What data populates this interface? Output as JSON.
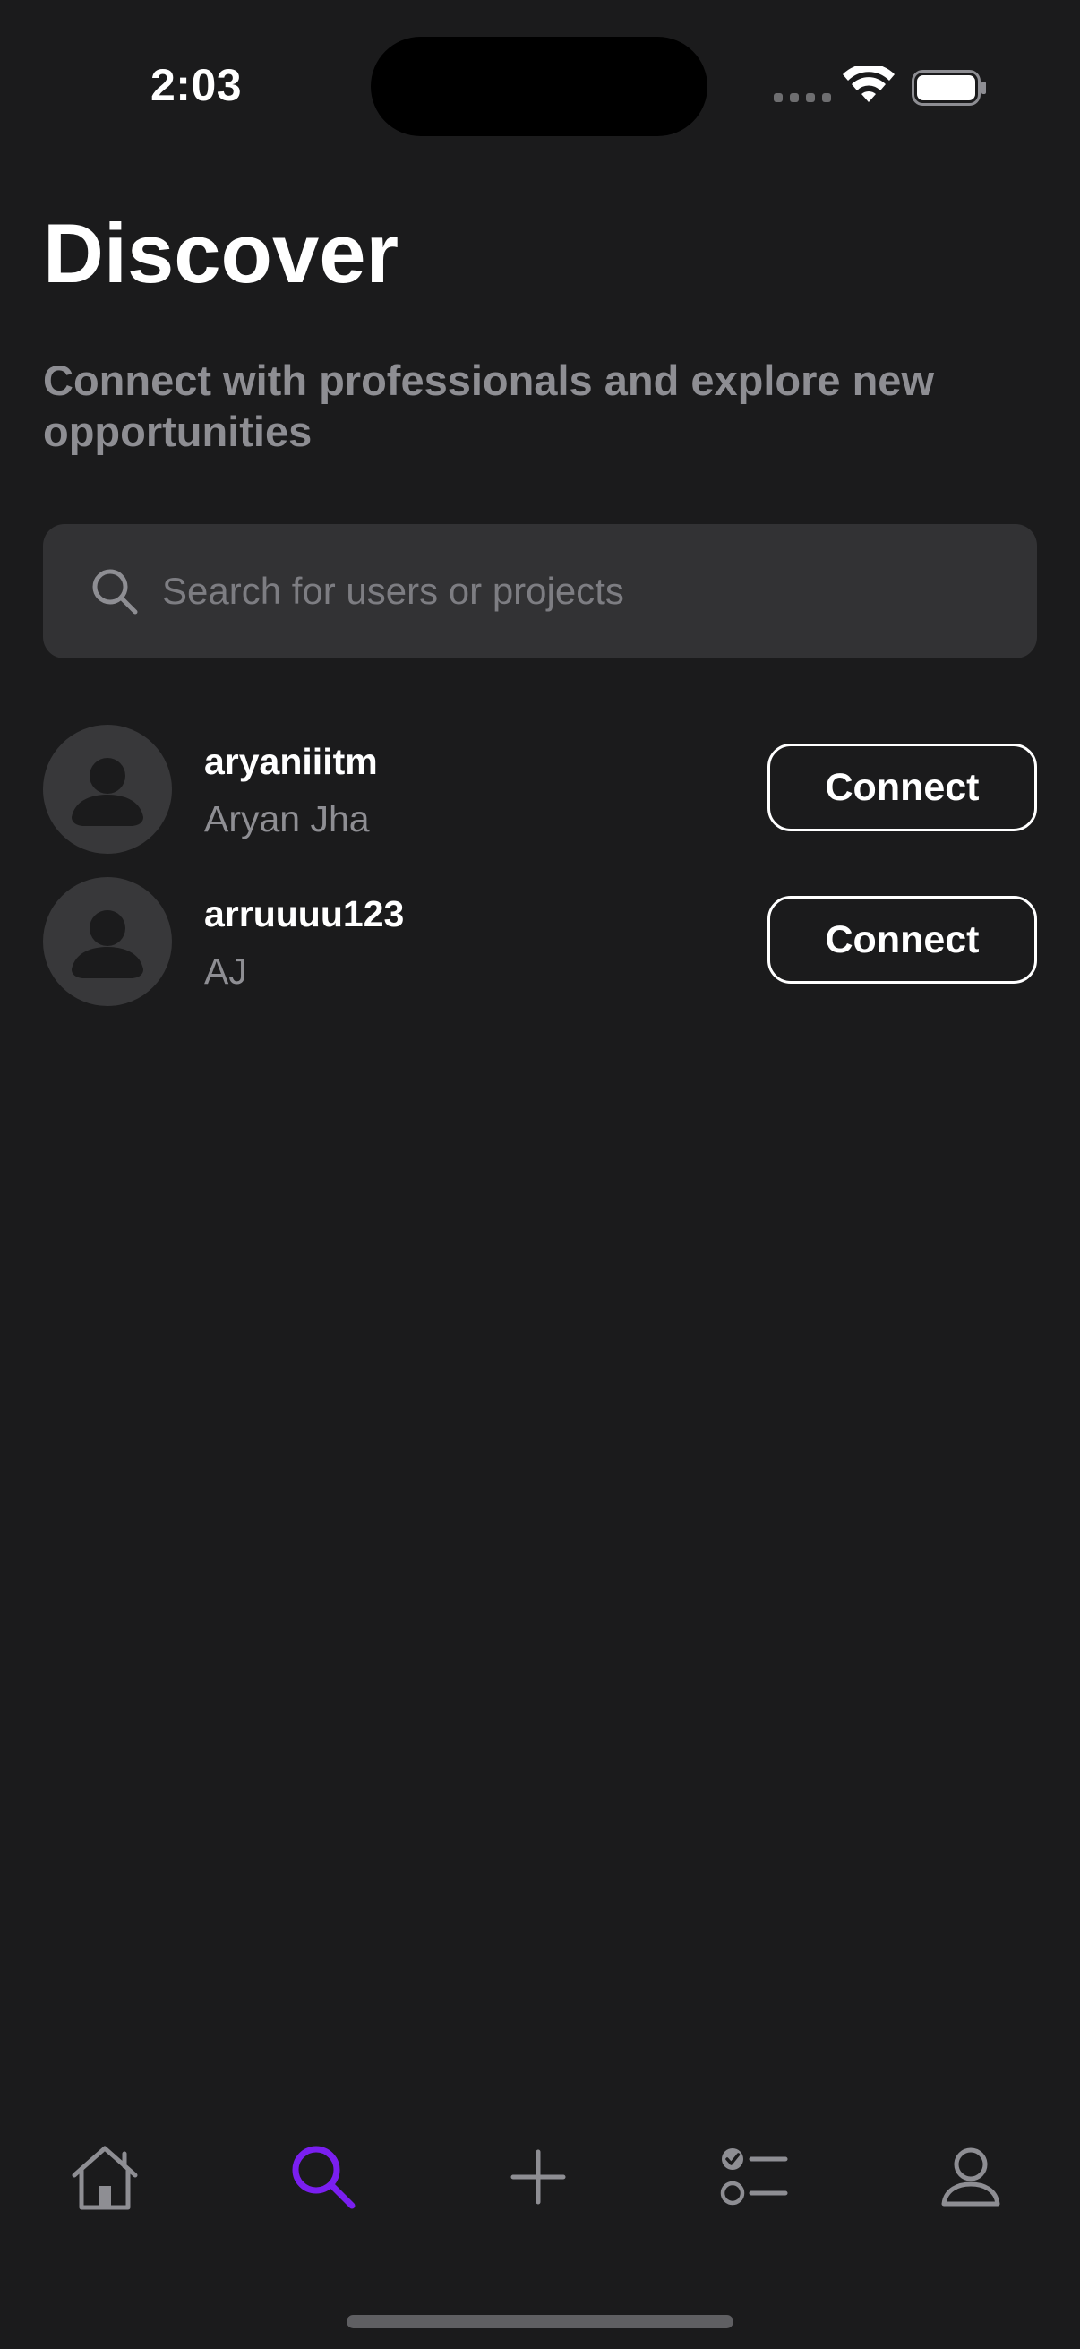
{
  "status_bar": {
    "time": "2:03"
  },
  "header": {
    "title": "Discover",
    "subtitle": "Connect with professionals and explore new opportunities"
  },
  "search": {
    "placeholder": "Search for users or projects",
    "value": "",
    "icon": "search-icon"
  },
  "users": [
    {
      "username": "aryaniiitm",
      "full_name": "Aryan Jha",
      "button_label": "Connect",
      "avatar_icon": "person-icon"
    },
    {
      "username": "arruuuu123",
      "full_name": "AJ",
      "button_label": "Connect",
      "avatar_icon": "person-icon"
    }
  ],
  "tab_bar": {
    "items": [
      {
        "icon": "home-icon",
        "active": false
      },
      {
        "icon": "search-icon",
        "active": true
      },
      {
        "icon": "plus-icon",
        "active": false
      },
      {
        "icon": "checklist-icon",
        "active": false
      },
      {
        "icon": "profile-icon",
        "active": false
      }
    ]
  },
  "colors": {
    "background": "#1b1b1c",
    "accent": "#7a1ff0",
    "inactive_icon": "#8e8e93",
    "secondary_text": "#8e8e93",
    "search_field": "#323234",
    "avatar_bg": "#38383a"
  }
}
